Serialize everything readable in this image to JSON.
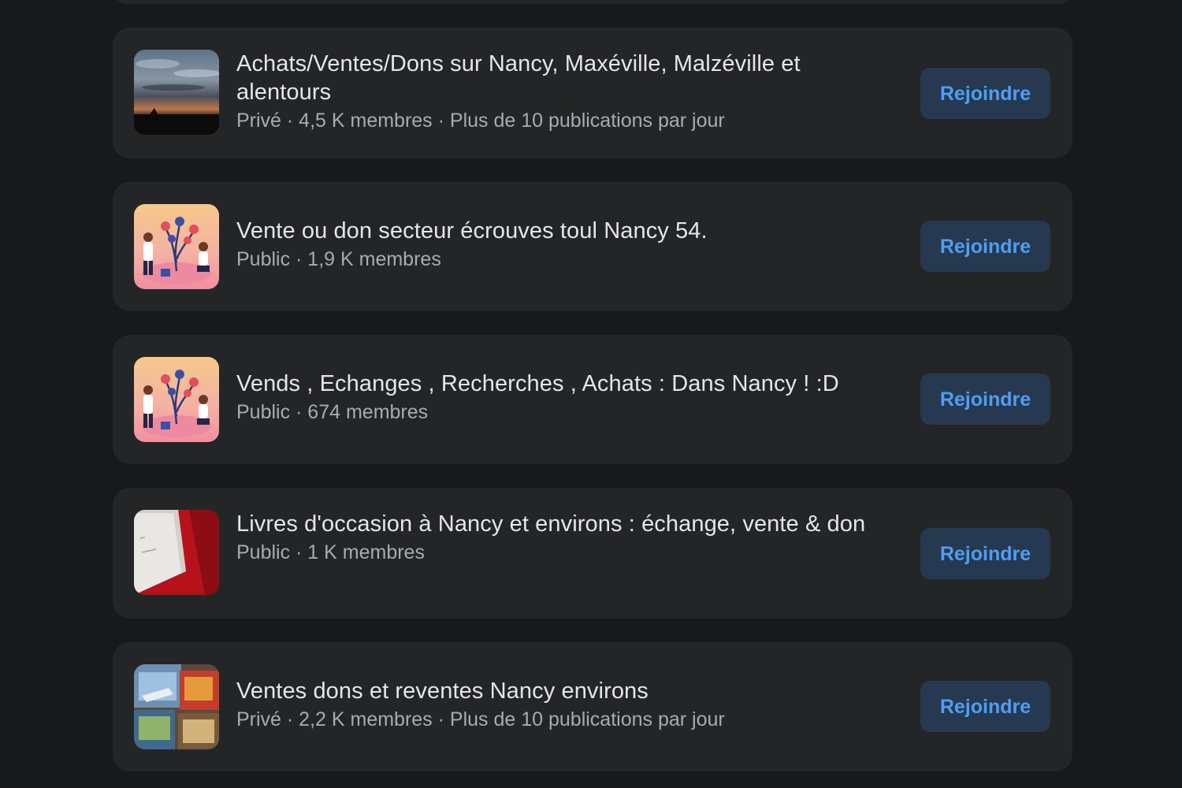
{
  "groups": [
    {
      "title": "Achats/Ventes/Dons sur Nancy, Maxéville, Malzéville et alentours",
      "meta": "Privé · 4,5 K membres · Plus de 10 publications par jour",
      "button": "Rejoindre",
      "thumb": "sunset-photo"
    },
    {
      "title": "Vente ou don secteur écrouves toul Nancy 54.",
      "meta": "Public · 1,9 K membres",
      "button": "Rejoindre",
      "thumb": "people-planting-illustration"
    },
    {
      "title": "Vends , Echanges , Recherches , Achats : Dans Nancy ! :D",
      "meta": "Public · 674 membres",
      "button": "Rejoindre",
      "thumb": "people-planting-illustration"
    },
    {
      "title": "Livres d'occasion à Nancy et environs : échange, vente & don",
      "meta": "Public · 1 K membres",
      "button": "Rejoindre",
      "thumb": "book-photo"
    },
    {
      "title": "Ventes dons et reventes Nancy environs",
      "meta": "Privé · 2,2 K membres · Plus de 10 publications par jour",
      "button": "Rejoindre",
      "thumb": "toys-photo"
    }
  ],
  "colors": {
    "background": "#18191a",
    "card": "#242526",
    "button_bg": "#263951",
    "button_text": "#4f9ef2",
    "title_text": "#e4e6eb",
    "meta_text": "#a8abaf"
  }
}
